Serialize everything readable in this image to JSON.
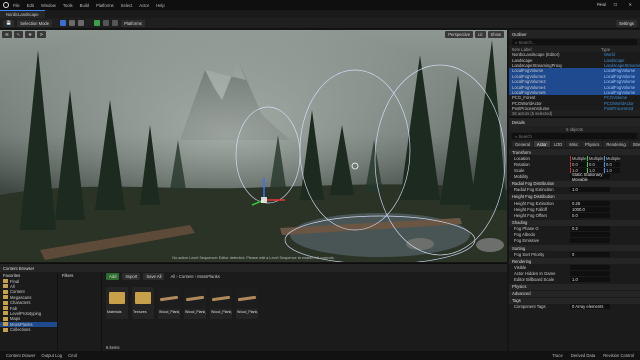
{
  "app": {
    "menu": [
      "File",
      "Edit",
      "Window",
      "Tools",
      "Build",
      "Platforms",
      "Select",
      "Actor",
      "Help"
    ],
    "project_name": "Final",
    "window_controls": "— ☐ ✕"
  },
  "level_tab": {
    "label": "NordicLandscape"
  },
  "toolbar": {
    "save_label": "💾",
    "mode_label": "Selection Mode",
    "platforms_label": "Platforms",
    "settings_label": "Settings"
  },
  "viewport": {
    "view_label": "Perspective",
    "lit_label": "Lit",
    "show_label": "Show",
    "message": "No active Level Sequencer Editor detected. Please edit a Level Sequence to enable full controls."
  },
  "outliner": {
    "title": "Outliner",
    "search_placeholder": "Search...",
    "col_label": "Item Label",
    "col_type": "Type",
    "rows": [
      {
        "name": "NordicLandscape (Editor)",
        "type": "World",
        "selected": false
      },
      {
        "name": "Landscape",
        "type": "Landscape",
        "selected": false
      },
      {
        "name": "LandscapeStreamingProxy",
        "type": "LandscapeStreaming",
        "selected": false
      },
      {
        "name": "LocalFogVolume",
        "type": "LocalFogVolume",
        "selected": true
      },
      {
        "name": "LocalFogVolume2",
        "type": "LocalFogVolume",
        "selected": true
      },
      {
        "name": "LocalFogVolume3",
        "type": "LocalFogVolume",
        "selected": true
      },
      {
        "name": "LocalFogVolume4",
        "type": "LocalFogVolume",
        "selected": true
      },
      {
        "name": "LocalFogVolume5",
        "type": "LocalFogVolume",
        "selected": true
      },
      {
        "name": "PCG_Forest",
        "type": "PCGVolume",
        "selected": false
      },
      {
        "name": "PCGWorldActor",
        "type": "PCGWorldActor",
        "selected": false
      },
      {
        "name": "PostProcessVolume",
        "type": "PostProcessVol",
        "selected": false
      },
      {
        "name": "SkyAtmosphere",
        "type": "SkyAtmosphere",
        "selected": false
      }
    ],
    "footer": "36 actors (5 selected)"
  },
  "details": {
    "title": "Details",
    "selection_label": "5 objects",
    "search_placeholder": "Search",
    "tabs": [
      "General",
      "Actor",
      "LOD",
      "Misc",
      "Physics",
      "Rendering",
      "Streaming",
      "All"
    ],
    "sections": [
      {
        "title": "Transform",
        "props": [
          {
            "label": "Location",
            "values": [
              "Multiple",
              "Multiple",
              "Multiple"
            ]
          },
          {
            "label": "Rotation",
            "values": [
              "0.0",
              "0.0",
              "0.0"
            ]
          },
          {
            "label": "Scale",
            "values": [
              "1.0",
              "1.0",
              "1.0"
            ]
          },
          {
            "label": "Mobility",
            "value": "Static  Stationary  Movable"
          }
        ]
      },
      {
        "title": "Radial Fog Distribution",
        "props": [
          {
            "label": "Radial Fog Extinction",
            "value": "1.0"
          }
        ]
      },
      {
        "title": "Height Fog Distribution",
        "props": [
          {
            "label": "Height Fog Extinction",
            "value": "0.25"
          },
          {
            "label": "Height Fog Falloff",
            "value": "1000.0"
          },
          {
            "label": "Height Fog Offset",
            "value": "0.0"
          }
        ]
      },
      {
        "title": "Shading",
        "props": [
          {
            "label": "Fog Phase G",
            "value": "0.2"
          },
          {
            "label": "Fog Albedo",
            "value": ""
          },
          {
            "label": "Fog Emissive",
            "value": ""
          }
        ]
      },
      {
        "title": "Sorting",
        "props": [
          {
            "label": "Fog Sort Priority",
            "value": "0"
          }
        ]
      },
      {
        "title": "Rendering",
        "props": [
          {
            "label": "Visible",
            "value": ""
          },
          {
            "label": "Actor Hidden In Game",
            "value": ""
          },
          {
            "label": "Editor Billboard Scale",
            "value": "1.0"
          }
        ]
      },
      {
        "title": "Physics",
        "props": []
      },
      {
        "title": "Advanced",
        "props": []
      },
      {
        "title": "Tags",
        "props": [
          {
            "label": "Component Tags",
            "value": "0 Array elements"
          }
        ]
      }
    ]
  },
  "content_browser": {
    "title": "Content Browser",
    "add_label": "Add",
    "import_label": "Import",
    "save_all_label": "Save All",
    "breadcrumb": [
      "All",
      "Content",
      "MossPlanks"
    ],
    "favorites_label": "Favorites",
    "filters_label": "Filters",
    "tree": [
      {
        "label": "Final",
        "selected": false
      },
      {
        "label": "All",
        "selected": false
      },
      {
        "label": "Content",
        "selected": false
      },
      {
        "label": "Megascans",
        "selected": false
      },
      {
        "label": "Characters",
        "selected": false
      },
      {
        "label": "Fab",
        "selected": false
      },
      {
        "label": "LevelPrototyping",
        "selected": false
      },
      {
        "label": "Maps",
        "selected": false
      },
      {
        "label": "MossPlanks",
        "selected": true
      },
      {
        "label": "Collections",
        "selected": false
      }
    ],
    "assets": [
      {
        "label": "Materials",
        "kind": "folder"
      },
      {
        "label": "Textures",
        "kind": "folder"
      },
      {
        "label": "Wood_Plank_1",
        "kind": "mesh"
      },
      {
        "label": "Wood_Plank_2",
        "kind": "mesh"
      },
      {
        "label": "Wood_Plank_3",
        "kind": "mesh"
      },
      {
        "label": "Wood_Plank_4",
        "kind": "mesh"
      }
    ],
    "item_count": "6 items"
  },
  "statusbar": {
    "left": [
      "Content Drawer",
      "Output Log",
      "Cmd"
    ],
    "right": [
      "Trace",
      "Derived Data",
      "Revision Control"
    ]
  },
  "colors": {
    "accent": "#1f4a8f",
    "folder": "#c9a04a",
    "type_text": "#3f8fd8"
  }
}
